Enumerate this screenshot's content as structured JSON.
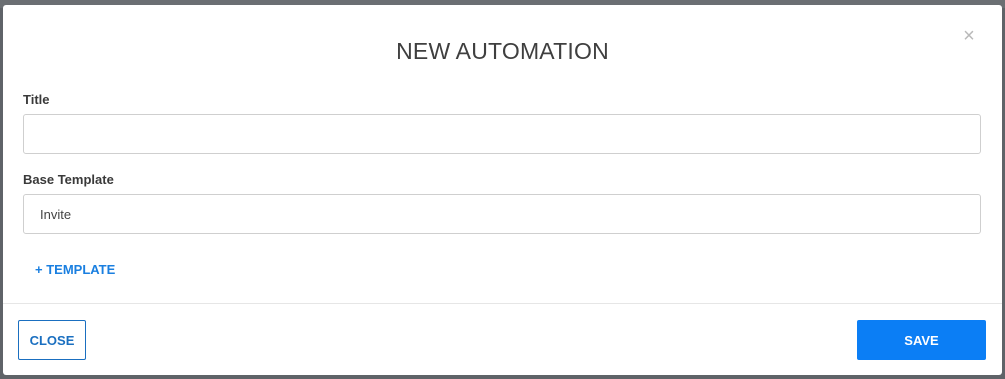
{
  "modal": {
    "title": "NEW AUTOMATION",
    "close_icon": "close-icon",
    "close_glyph": "×"
  },
  "form": {
    "title_label": "Title",
    "title_value": "",
    "base_template_label": "Base Template",
    "base_template_value": "Invite",
    "add_template_label": "+ TEMPLATE"
  },
  "footer": {
    "close_label": "CLOSE",
    "save_label": "SAVE"
  },
  "colors": {
    "accent": "#0b7ef5",
    "link": "#1a7fe0",
    "outline_button": "#1a6fc0"
  }
}
